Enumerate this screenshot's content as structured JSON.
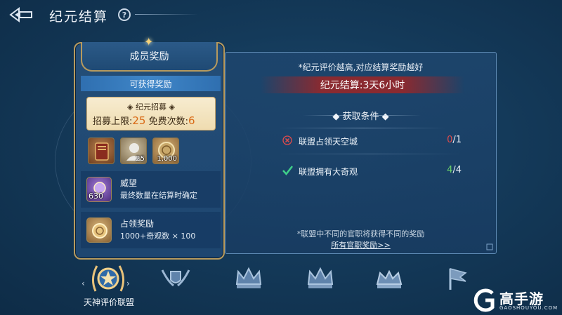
{
  "header": {
    "title": "纪元结算",
    "help_label": "?"
  },
  "left_card": {
    "title": "成员奖励",
    "subtitle": "可获得奖励",
    "recruit": {
      "title": "纪元招募",
      "limit_label": "招募上限:",
      "limit_value": "25",
      "free_label": "免费次数:",
      "free_value": "6"
    },
    "items": [
      {
        "icon": "book-icon",
        "count": ""
      },
      {
        "icon": "statue-bust-icon",
        "count": "25"
      },
      {
        "icon": "coin-icon",
        "count": "1,000"
      }
    ],
    "prestige": {
      "icon": "prestige-medal-icon",
      "name": "威望",
      "desc": "最终数量在结算时确定",
      "count": "630"
    },
    "occupy": {
      "icon": "gold-coin-icon",
      "name": "占领奖励",
      "desc": "1000+奇观数 × 100"
    }
  },
  "right_panel": {
    "tip": "*纪元评价越高,对应结算奖励越好",
    "settle": "纪元结算:3天6小时",
    "conditions_title": "获取条件",
    "conditions": [
      {
        "status": "failed",
        "icon": "cross-icon",
        "label": "联盟占领天空城",
        "current": "0",
        "total": "/1"
      },
      {
        "status": "done",
        "icon": "check-icon",
        "label": "联盟拥有大奇观",
        "current": "4",
        "total": "/4"
      }
    ],
    "note": "*联盟中不同的官职将获得不同的奖励",
    "link": "所有官职奖励>>"
  },
  "tiers": {
    "selected_label": "天神评价联盟",
    "items": [
      "laurel-star-emblem-icon",
      "winged-shield-icon",
      "crown-icon",
      "crown-icon",
      "crown-icon",
      "flag-icon"
    ]
  },
  "brand": {
    "name": "高手游",
    "sub": "GAOSHOUYOU.COM"
  },
  "colors": {
    "gold_border": "#b79a5e",
    "red": "#e24b4b",
    "green": "#6bd36b",
    "orange": "#d96a16"
  }
}
